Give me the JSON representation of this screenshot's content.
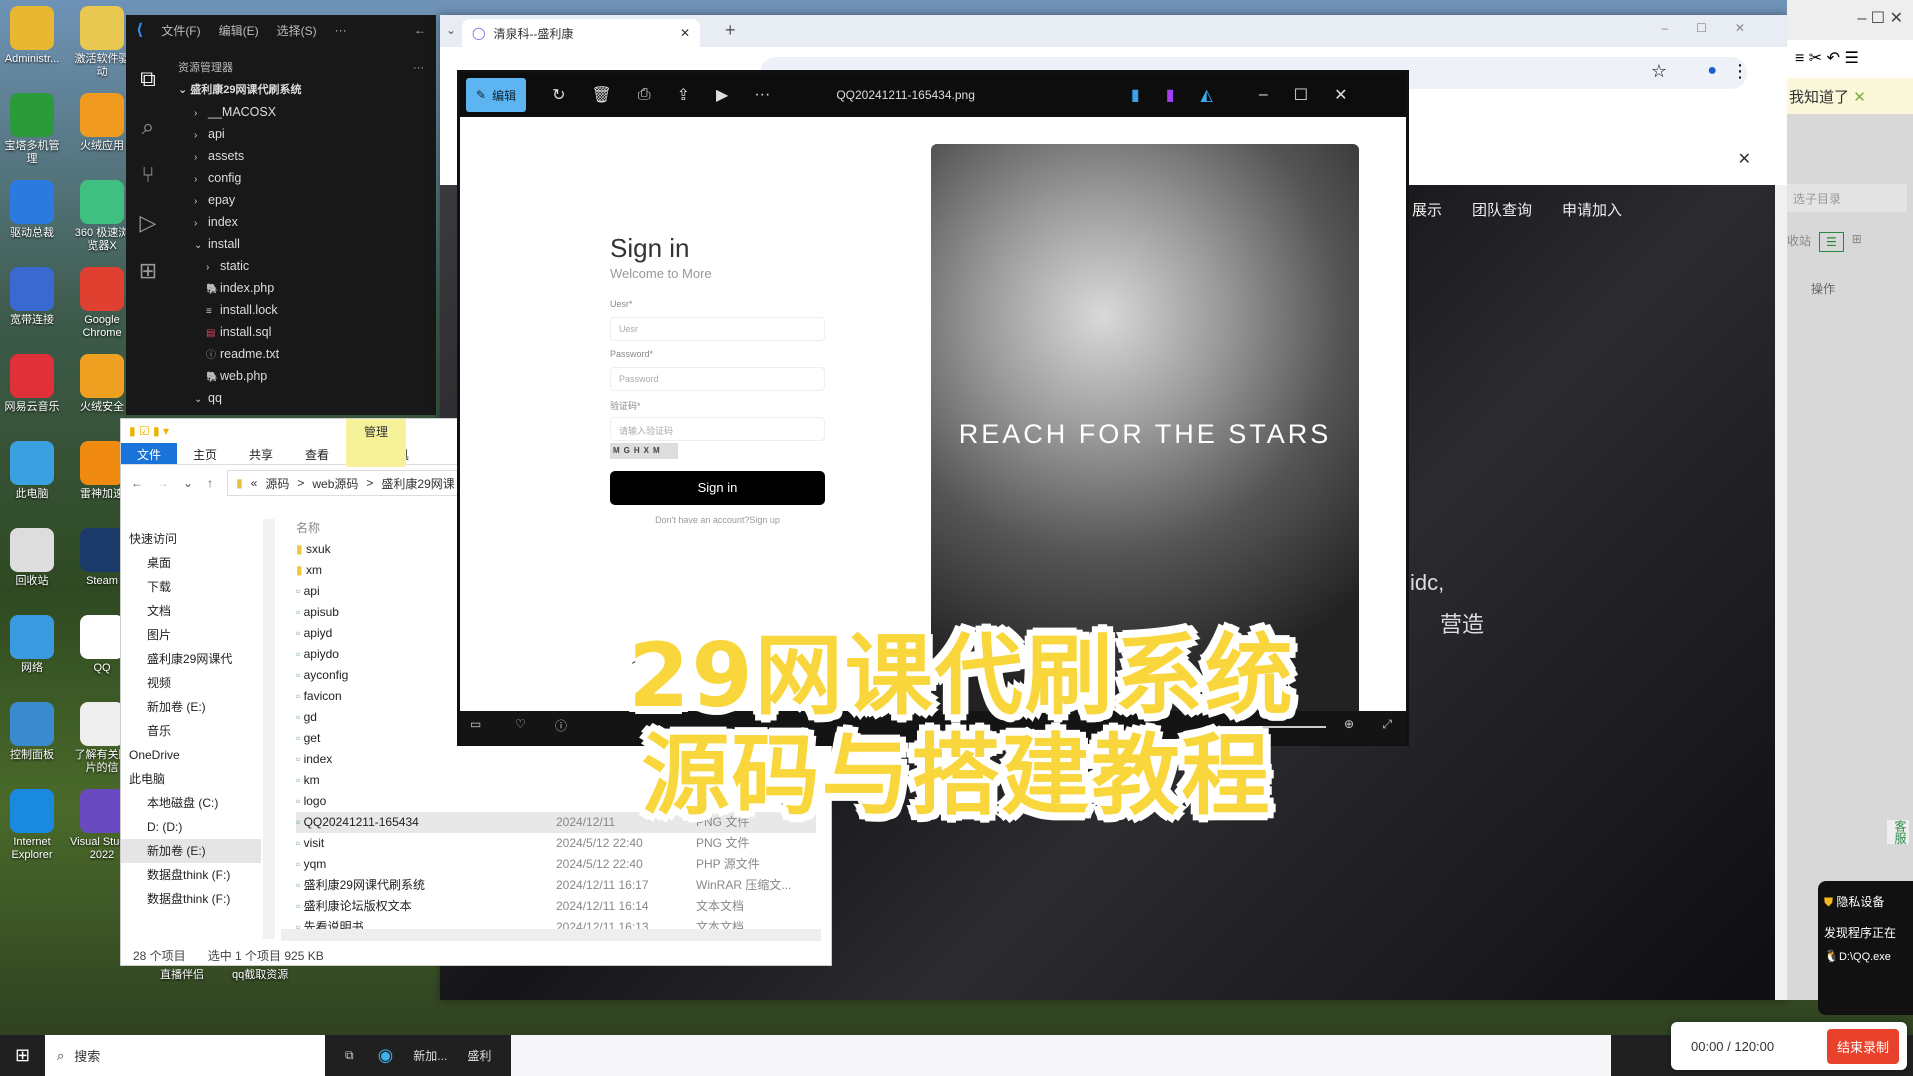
{
  "desktop": {
    "col1": [
      "Administr...",
      "宝塔多机管理",
      "驱动总裁",
      "宽带连接",
      "网易云音乐",
      "此电脑",
      "回收站",
      "网络",
      "控制面板",
      "Internet Explorer"
    ],
    "col2": [
      "激活软件驱动",
      "火绒应用",
      "360 极速浏览器X",
      "Google Chrome",
      "火绒安全",
      "雷神加速",
      "Steam",
      "QQ",
      "了解有关图片的信",
      "Visual Studio 2022"
    ],
    "bottom": [
      "直播伴侣",
      "qq截取资源"
    ]
  },
  "vscode": {
    "menu": [
      "文件(F)",
      "编辑(E)",
      "选择(S)",
      "···"
    ],
    "panel_title": "资源管理器",
    "root": "盛利康29网课代刷系统",
    "tree": [
      {
        "l": "__MACOSX",
        "d": 1,
        "c": ">"
      },
      {
        "l": "api",
        "d": 1,
        "c": ">"
      },
      {
        "l": "assets",
        "d": 1,
        "c": ">"
      },
      {
        "l": "config",
        "d": 1,
        "c": ">"
      },
      {
        "l": "epay",
        "d": 1,
        "c": ">"
      },
      {
        "l": "index",
        "d": 1,
        "c": ">"
      },
      {
        "l": "install",
        "d": 1,
        "c": "v"
      },
      {
        "l": "static",
        "d": 2,
        "c": ">"
      },
      {
        "l": "index.php",
        "d": 2,
        "c": "php"
      },
      {
        "l": "install.lock",
        "d": 2,
        "c": "lock"
      },
      {
        "l": "install.sql",
        "d": 2,
        "c": "sql"
      },
      {
        "l": "readme.txt",
        "d": 2,
        "c": "info"
      },
      {
        "l": "web.php",
        "d": 2,
        "c": "php"
      },
      {
        "l": "qq",
        "d": 1,
        "c": "v"
      }
    ]
  },
  "browser": {
    "tab_title": "清泉科--盛利康",
    "nav_links": [
      "展示",
      "团队查询",
      "申请加入"
    ],
    "bg_text": [
      "idc,",
      "营造"
    ]
  },
  "viewer": {
    "edit_label": "编辑",
    "filename": "QQ20241211-165434.png",
    "form": {
      "title": "Sign in",
      "subtitle": "Welcome to More",
      "user_label": "Uesr*",
      "user_placeholder": "Uesr",
      "pass_label": "Password*",
      "pass_placeholder": "Password",
      "code_label": "验证码*",
      "code_placeholder": "请输入验证码",
      "captcha": "MGHXM",
      "button": "Sign in",
      "signup": "Don't have an account?Sign up"
    },
    "image_text": "REACH FOR THE STARS"
  },
  "explorer": {
    "ribbon_tabs": [
      "文件",
      "主页",
      "共享",
      "查看",
      "图片工具"
    ],
    "manage_tab": "管理",
    "breadcrumb": [
      "«",
      "源码",
      ">",
      "web源码",
      ">",
      "盛利康29网课"
    ],
    "col_name": "名称",
    "nav": [
      "快速访问",
      "桌面",
      "下载",
      "文档",
      "图片",
      "盛利康29网课代",
      "视频",
      "新加卷 (E:)",
      "音乐",
      "OneDrive",
      "此电脑",
      "本地磁盘 (C:)",
      "D: (D:)",
      "新加卷 (E:)",
      "数据盘think (F:)",
      "数据盘think (F:)"
    ],
    "files": [
      [
        "sxuk",
        "",
        ""
      ],
      [
        "xm",
        "",
        ""
      ],
      [
        "api",
        "",
        ""
      ],
      [
        "apisub",
        "",
        ""
      ],
      [
        "apiyd",
        "",
        ""
      ],
      [
        "apiydo",
        "",
        ""
      ],
      [
        "ayconfig",
        "",
        ""
      ],
      [
        "favicon",
        "",
        ""
      ],
      [
        "gd",
        "",
        ""
      ],
      [
        "get",
        "",
        ""
      ],
      [
        "index",
        "",
        ""
      ],
      [
        "km",
        "",
        ""
      ],
      [
        "logo",
        "",
        ""
      ],
      [
        "QQ20241211-165434",
        "2024/12/11",
        "PNG 文件"
      ],
      [
        "visit",
        "2024/5/12 22:40",
        "PNG 文件"
      ],
      [
        "yqm",
        "2024/5/12 22:40",
        "PHP 源文件"
      ],
      [
        "盛利康29网课代刷系统",
        "2024/12/11 16:17",
        "WinRAR 压缩文..."
      ],
      [
        "盛利康论坛版权文本",
        "2024/12/11 16:14",
        "文本文档"
      ],
      [
        "先看说明书",
        "2024/12/11 16:13",
        "文本文档"
      ]
    ],
    "status_count": "28 个项目",
    "status_selected": "选中 1 个项目  925 KB"
  },
  "right_app": {
    "notice": "我知道了",
    "search": "选子目录",
    "recycle": "收站",
    "op": "操作",
    "service": "客服"
  },
  "privacy": {
    "title": "隐私设备",
    "msg": "发现程序正在",
    "app": "D:\\QQ.exe"
  },
  "recorder": {
    "time": "00:00 / 120:00",
    "stop": "结束录制"
  },
  "taskbar": {
    "search": "搜索",
    "items": [
      "新加...",
      "盛利"
    ]
  },
  "caption": {
    "line1": "29网课代刷系统",
    "line2": "源码与搭建教程"
  },
  "colors": {
    "caption_fill": "#f8d63c",
    "vscode_bg": "#181818",
    "explorer_accent": "#1a73d9",
    "record_red": "#e8412c"
  }
}
